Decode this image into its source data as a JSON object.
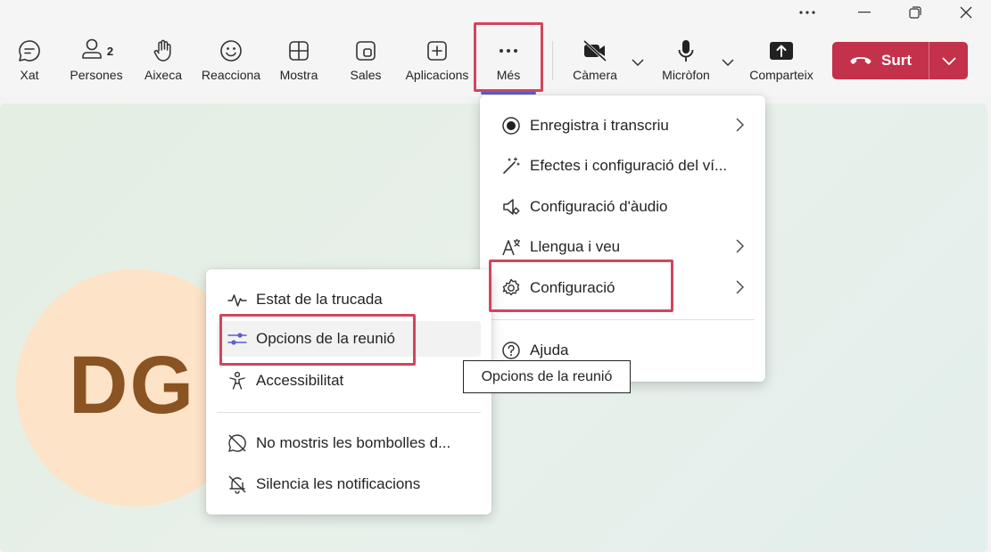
{
  "toolbar": {
    "xat": "Xat",
    "persones": "Persones",
    "persones_count": "2",
    "aixeca": "Aixeca",
    "reacciona": "Reacciona",
    "mostra": "Mostra",
    "sales": "Sales",
    "aplicacions": "Aplicacions",
    "mes": "Més",
    "camera": "Càmera",
    "microfon": "Micròfon",
    "comparteix": "Comparteix",
    "surt": "Surt"
  },
  "more_menu": {
    "items": [
      {
        "label": "Enregistra i transcriu",
        "icon": "record-icon",
        "submenu": true
      },
      {
        "label": "Efectes i configuració del ví...",
        "icon": "magic-wand-icon",
        "submenu": false
      },
      {
        "label": "Configuració d'àudio",
        "icon": "speaker-settings-icon",
        "submenu": false
      },
      {
        "label": "Llengua i veu",
        "icon": "language-icon",
        "submenu": true
      },
      {
        "label": "Configuració",
        "icon": "gear-icon",
        "submenu": true
      },
      {
        "label": "Ajuda",
        "icon": "help-icon",
        "submenu": false
      }
    ]
  },
  "settings_submenu": {
    "items": [
      {
        "label": "Estat de la trucada",
        "icon": "pulse-icon"
      },
      {
        "label": "Opcions de la reunió",
        "icon": "sliders-icon"
      },
      {
        "label": "Accessibilitat",
        "icon": "accessibility-icon"
      },
      {
        "label": "No mostris les bombolles d...",
        "icon": "chat-off-icon"
      },
      {
        "label": "Silencia les notificacions",
        "icon": "bell-off-icon"
      }
    ]
  },
  "tooltip": "Opcions de la reunió",
  "avatar_initials": "DG",
  "colors": {
    "accent": "#5b5fc7",
    "leave": "#c4314b",
    "highlight": "#d1455d",
    "avatar_bg": "#fde3c7",
    "avatar_text": "#8a5322"
  }
}
